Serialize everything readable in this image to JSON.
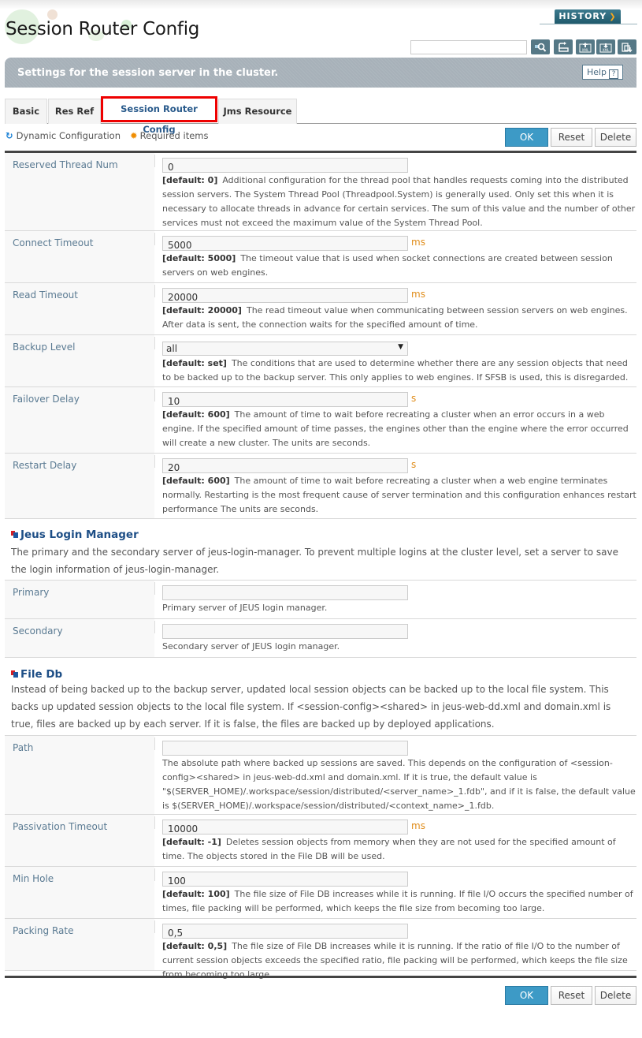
{
  "page": {
    "title": "Session Router Config",
    "description": "Settings for the session server in the cluster.",
    "history_label": "HISTORY",
    "help_label": "Help",
    "search_placeholder": ""
  },
  "toolbar_icons": [
    "search-icon",
    "refresh-icon",
    "xml-upload-icon",
    "xml-download-icon",
    "export-icon"
  ],
  "tabs": [
    {
      "label": "Basic",
      "active": false
    },
    {
      "label": "Res Ref",
      "active": false
    },
    {
      "label": "Session Router Config",
      "active": true
    },
    {
      "label": "Jms Resource",
      "active": false
    }
  ],
  "legend": {
    "dynamic": "Dynamic Configuration",
    "required": "Required items"
  },
  "buttons": {
    "ok": "OK",
    "reset": "Reset",
    "delete": "Delete"
  },
  "fields": [
    {
      "label": "Reserved Thread Num",
      "value": "0",
      "unit": "",
      "default": "[default: 0]",
      "help": "Additional configuration for the thread pool that handles requests coming into the distributed session servers. The System Thread Pool (Threadpool.System) is generally used. Only set this when it is necessary to allocate threads in advance for certain services. The sum of this value and the number of other services must not exceed the maximum value of the System Thread Pool."
    },
    {
      "label": "Connect Timeout",
      "value": "5000",
      "unit": "ms",
      "default": "[default: 5000]",
      "help": "The timeout value that is used when socket connections are created between session servers on web engines."
    },
    {
      "label": "Read Timeout",
      "value": "20000",
      "unit": "ms",
      "default": "[default: 20000]",
      "help": "The read timeout value when communicating between session servers on web engines. After data is sent, the connection waits for the specified amount of time."
    },
    {
      "label": "Backup Level",
      "value": "all",
      "unit": "",
      "default": "[default: set]",
      "help": "The conditions that are used to determine whether there are any session objects that need to be backed up to the backup server. This only applies to web engines. If SFSB is used, this is disregarded."
    },
    {
      "label": "Failover Delay",
      "value": "10",
      "unit": "s",
      "default": "[default: 600]",
      "help": "The amount of time to wait before recreating a cluster when an error occurs in a web engine. If the specified amount of time passes, the engines other than the engine where the error occurred will create a new cluster. The units are seconds."
    },
    {
      "label": "Restart Delay",
      "value": "20",
      "unit": "s",
      "default": "[default: 600]",
      "help": "The amount of time to wait before recreating a cluster when a web engine terminates normally. Restarting is the most frequent cause of server termination and this configuration enhances restart performance The units are seconds."
    }
  ],
  "jeus_login_manager": {
    "title": "Jeus Login Manager",
    "description": "The primary and the secondary server of jeus-login-manager. To prevent multiple logins at the cluster level, set a server to save the login information of jeus-login-manager.",
    "fields": [
      {
        "label": "Primary",
        "value": "",
        "help": "Primary server of JEUS login manager."
      },
      {
        "label": "Secondary",
        "value": "",
        "help": "Secondary server of JEUS login manager."
      }
    ]
  },
  "file_db": {
    "title": "File Db",
    "description": "Instead of being backed up to the backup server, updated local session objects can be backed up to the local file system. This backs up updated session objects to the local file system. If <session-config><shared> in jeus-web-dd.xml and domain.xml is true, files are backed up by each server. If it is false, the files are backed up by deployed applications.",
    "fields": [
      {
        "label": "Path",
        "value": "",
        "unit": "",
        "default": "",
        "help": "The absolute path where backed up sessions are saved. This depends on the configuration of <session-config><shared> in jeus-web-dd.xml and domain.xml. If it is true, the default value is \"$(SERVER_HOME)/.workspace/session/distributed/<server_name>_1.fdb\", and if it is false, the default value is $(SERVER_HOME)/.workspace/session/distributed/<context_name>_1.fdb."
      },
      {
        "label": "Passivation Timeout",
        "value": "10000",
        "unit": "ms",
        "default": "[default: -1]",
        "help": "Deletes session objects from memory when they are not used for the specified amount of time. The objects stored in the File DB will be used."
      },
      {
        "label": "Min Hole",
        "value": "100",
        "unit": "",
        "default": "[default: 100]",
        "help": "The file size of File DB increases while it is running. If file I/O occurs the specified number of times, file packing will be performed, which keeps the file size from becoming too large."
      },
      {
        "label": "Packing Rate",
        "value": "0,5",
        "unit": "",
        "default": "[default: 0,5]",
        "help": "The file size of File DB increases while it is running. If the ratio of file I/O to the number of current session objects exceeds the specified ratio, file packing will be performed, which keeps the file size from becoming too large."
      }
    ]
  }
}
